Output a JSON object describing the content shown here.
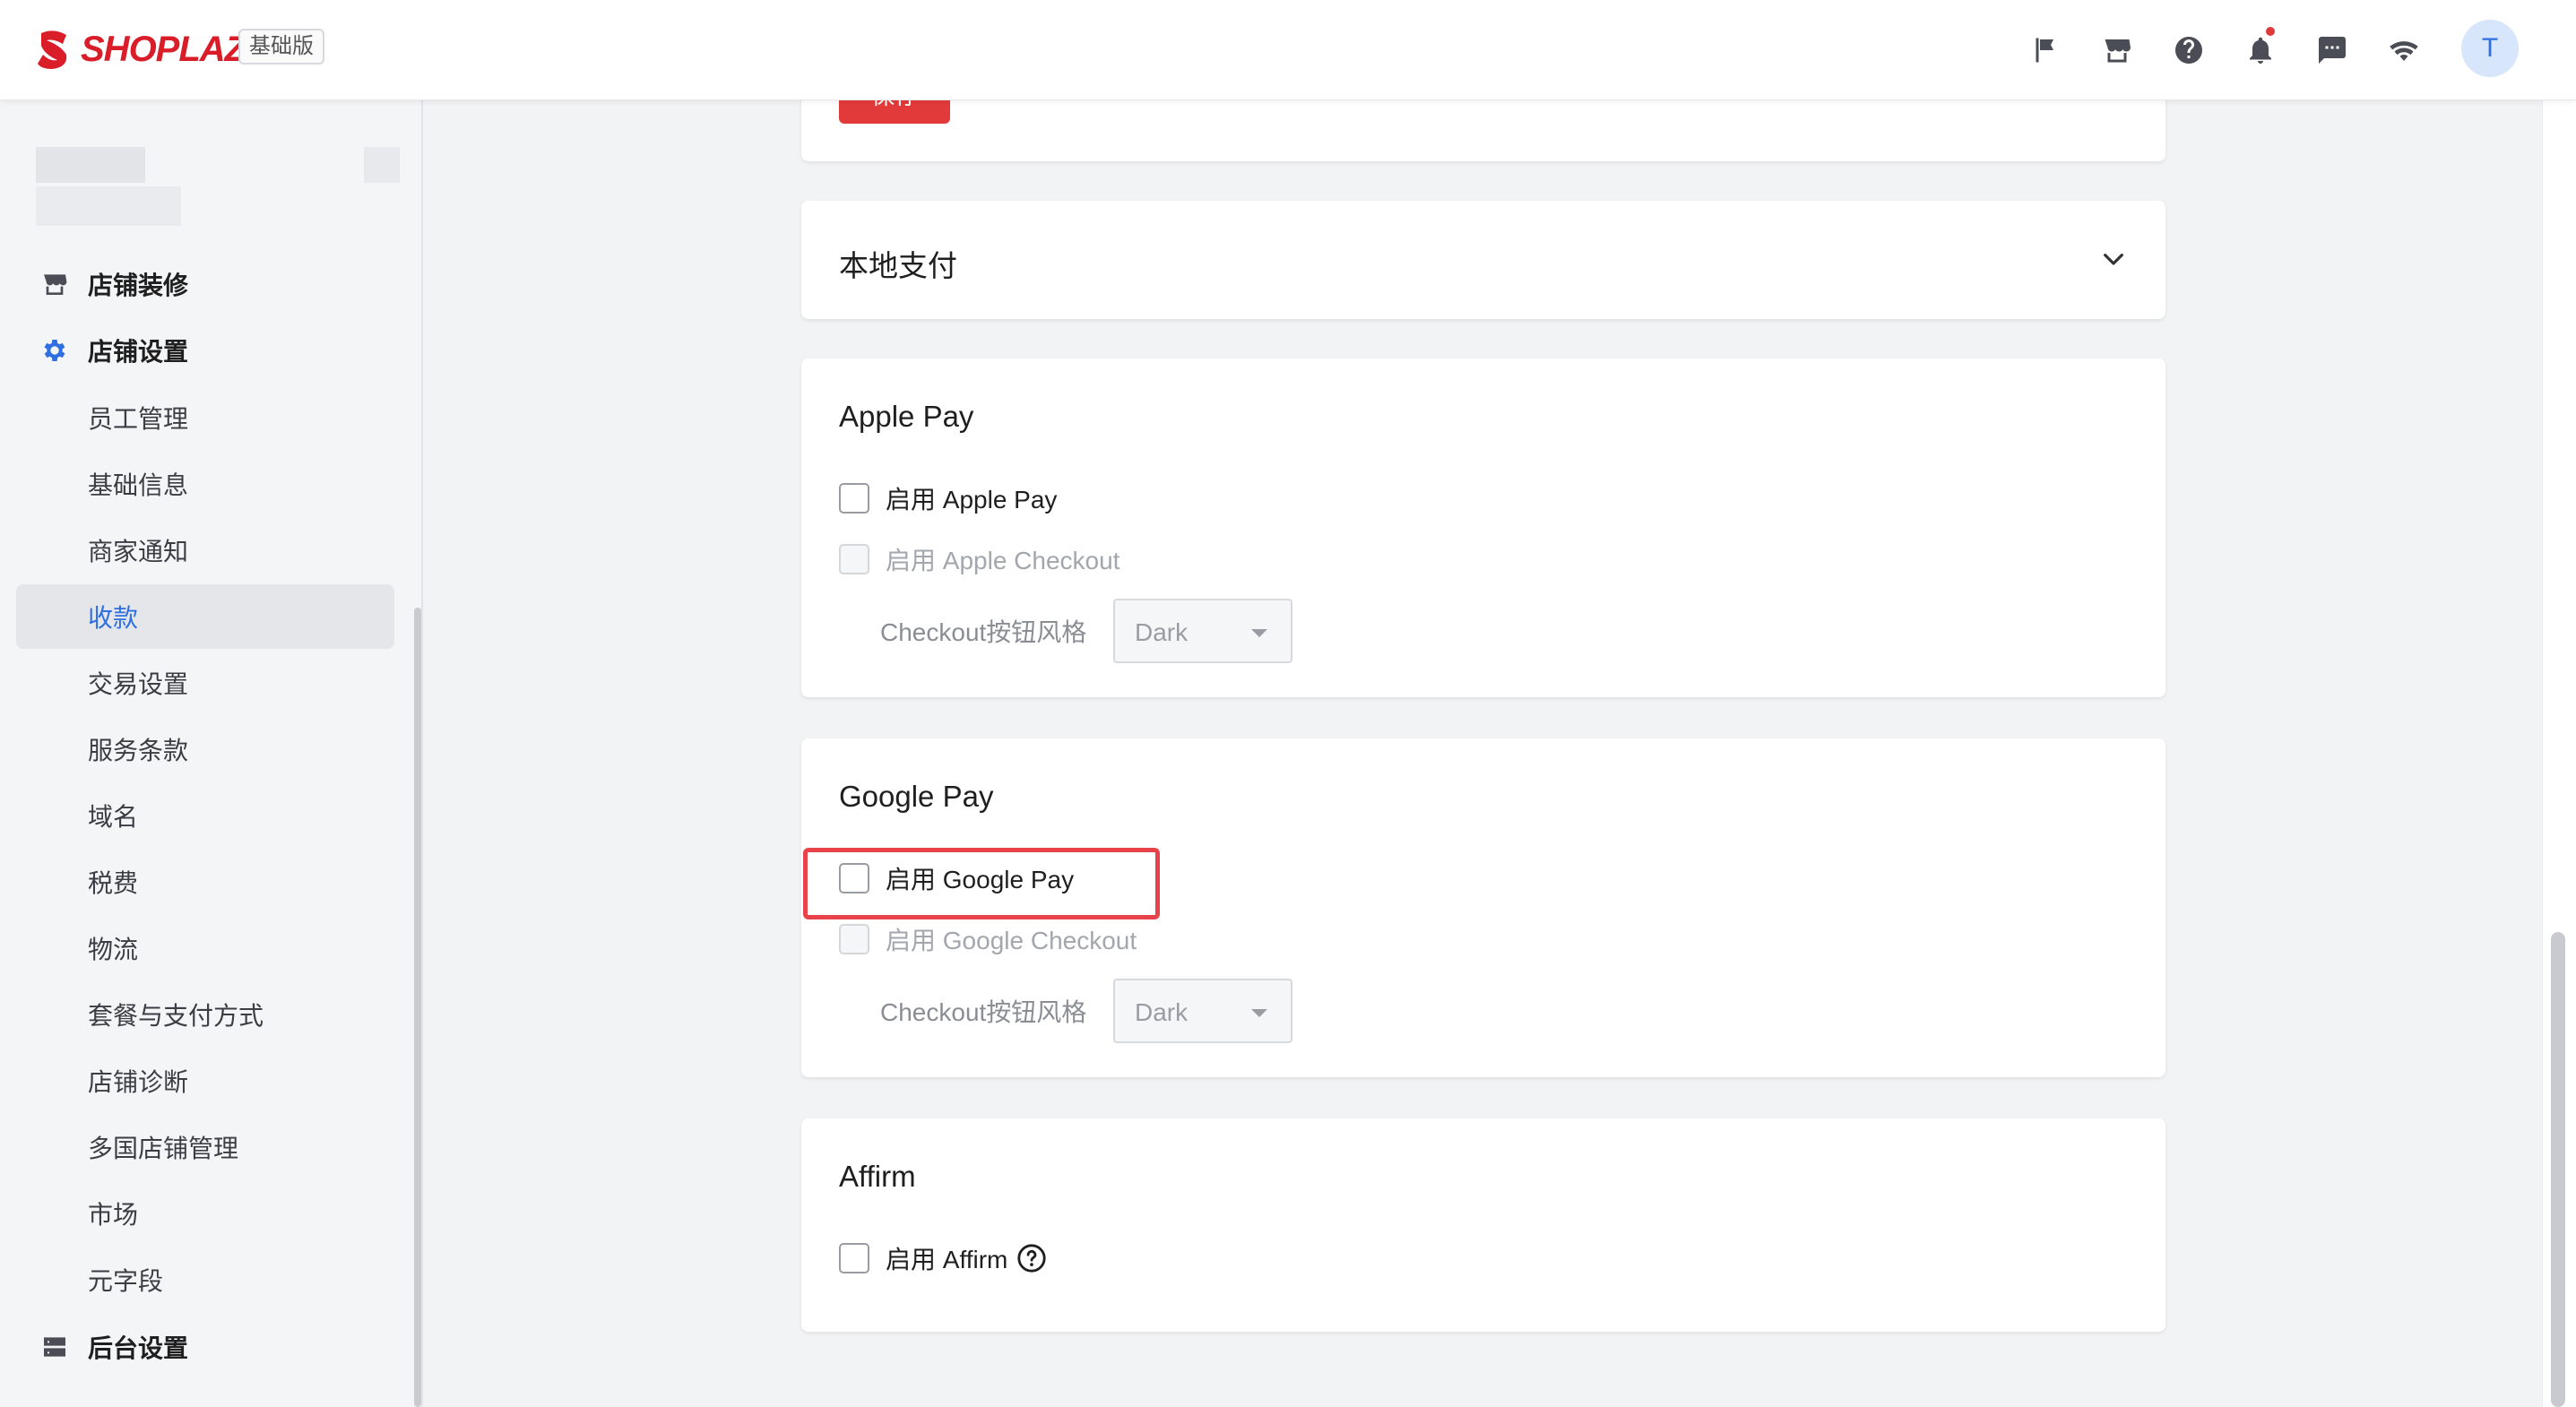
{
  "header": {
    "brand": "SHOPLAZZA",
    "plan_badge": "基础版",
    "avatar_initial": "T",
    "icons": [
      "flag-icon",
      "store-icon",
      "help-icon",
      "bell-icon",
      "message-icon",
      "wifi-icon"
    ]
  },
  "sidebar": {
    "groups": {
      "store_design": "店铺装修",
      "store_settings": "店铺设置",
      "admin_settings": "后台设置"
    },
    "items": [
      {
        "label": "员工管理",
        "active": false
      },
      {
        "label": "基础信息",
        "active": false
      },
      {
        "label": "商家通知",
        "active": false
      },
      {
        "label": "收款",
        "active": true
      },
      {
        "label": "交易设置",
        "active": false
      },
      {
        "label": "服务条款",
        "active": false
      },
      {
        "label": "域名",
        "active": false
      },
      {
        "label": "税费",
        "active": false
      },
      {
        "label": "物流",
        "active": false
      },
      {
        "label": "套餐与支付方式",
        "active": false
      },
      {
        "label": "店铺诊断",
        "active": false
      },
      {
        "label": "多国店铺管理",
        "active": false
      },
      {
        "label": "市场",
        "active": false
      },
      {
        "label": "元字段",
        "active": false
      }
    ],
    "accent_color": "#2f6fe0"
  },
  "main": {
    "save_button": "保存",
    "local_payment": {
      "title": "本地支付"
    },
    "apple_pay": {
      "title": "Apple Pay",
      "enable_label": "启用 Apple Pay",
      "checkout_label": "启用 Apple Checkout",
      "style_label": "Checkout按钮风格",
      "style_value": "Dark"
    },
    "google_pay": {
      "title": "Google Pay",
      "enable_label": "启用 Google Pay",
      "checkout_label": "启用 Google Checkout",
      "style_label": "Checkout按钮风格",
      "style_value": "Dark"
    },
    "affirm": {
      "title": "Affirm",
      "enable_label": "启用 Affirm"
    },
    "highlight_color": "#e8434a"
  }
}
